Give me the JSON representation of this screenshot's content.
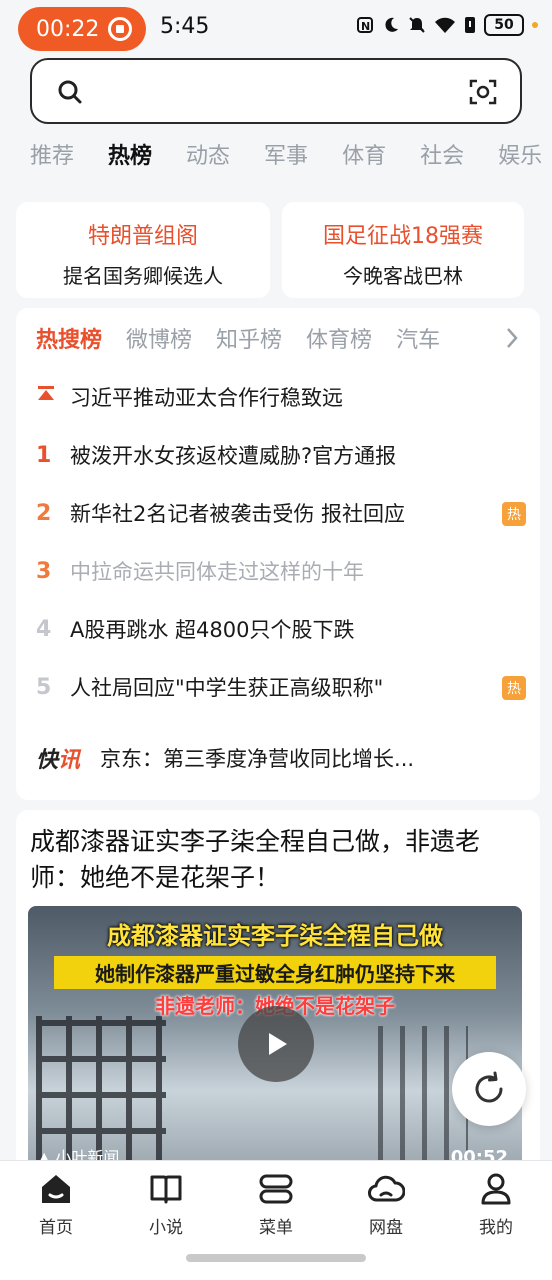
{
  "status_bar": {
    "recording_time": "00:22",
    "clock": "5:45",
    "battery": "50"
  },
  "search": {
    "placeholder": ""
  },
  "categories": [
    "推荐",
    "热榜",
    "动态",
    "军事",
    "体育",
    "社会",
    "娱乐"
  ],
  "top_cards": [
    {
      "headline": "特朗普组阁",
      "sub": "提名国务卿候选人"
    },
    {
      "headline": "国足征战18强赛",
      "sub": "今晚客战巴林"
    }
  ],
  "hot_tabs": [
    "热搜榜",
    "微博榜",
    "知乎榜",
    "体育榜",
    "汽车"
  ],
  "hot_list": [
    {
      "rank": "",
      "title": "习近平推动亚太合作行稳致远",
      "badge": ""
    },
    {
      "rank": "1",
      "title": "被泼开水女孩返校遭威胁?官方通报",
      "badge": ""
    },
    {
      "rank": "2",
      "title": "新华社2名记者被袭击受伤 报社回应",
      "badge": "热"
    },
    {
      "rank": "3",
      "title": "中拉命运共同体走过这样的十年",
      "badge": ""
    },
    {
      "rank": "4",
      "title": "A股再跳水 超4800只个股下跌",
      "badge": ""
    },
    {
      "rank": "5",
      "title": "人社局回应\"中学生获正高级职称\"",
      "badge": "热"
    }
  ],
  "flash": {
    "logo_a": "快",
    "logo_b": "讯",
    "text": "京东：第三季度净营收同比增长..."
  },
  "news": {
    "title": "成都漆器证实李子柒全程自己做，非遗老师：她绝不是花架子！",
    "video_caption_1": "成都漆器证实李子柒全程自己做",
    "video_caption_2": "她制作漆器严重过敏全身红肿仍坚持下来",
    "video_caption_3": "非遗老师：她绝不是花架子",
    "channel": "▲ 小叶新闻",
    "duration": "00:52"
  },
  "bottom_nav": [
    {
      "label": "首页",
      "icon": "home-icon"
    },
    {
      "label": "小说",
      "icon": "book-icon"
    },
    {
      "label": "菜单",
      "icon": "menu-icon"
    },
    {
      "label": "网盘",
      "icon": "cloud-icon"
    },
    {
      "label": "我的",
      "icon": "profile-icon"
    }
  ],
  "colors": {
    "accent": "#e8502e",
    "recording": "#f05a24",
    "hot_badge": "#f7a13a"
  }
}
